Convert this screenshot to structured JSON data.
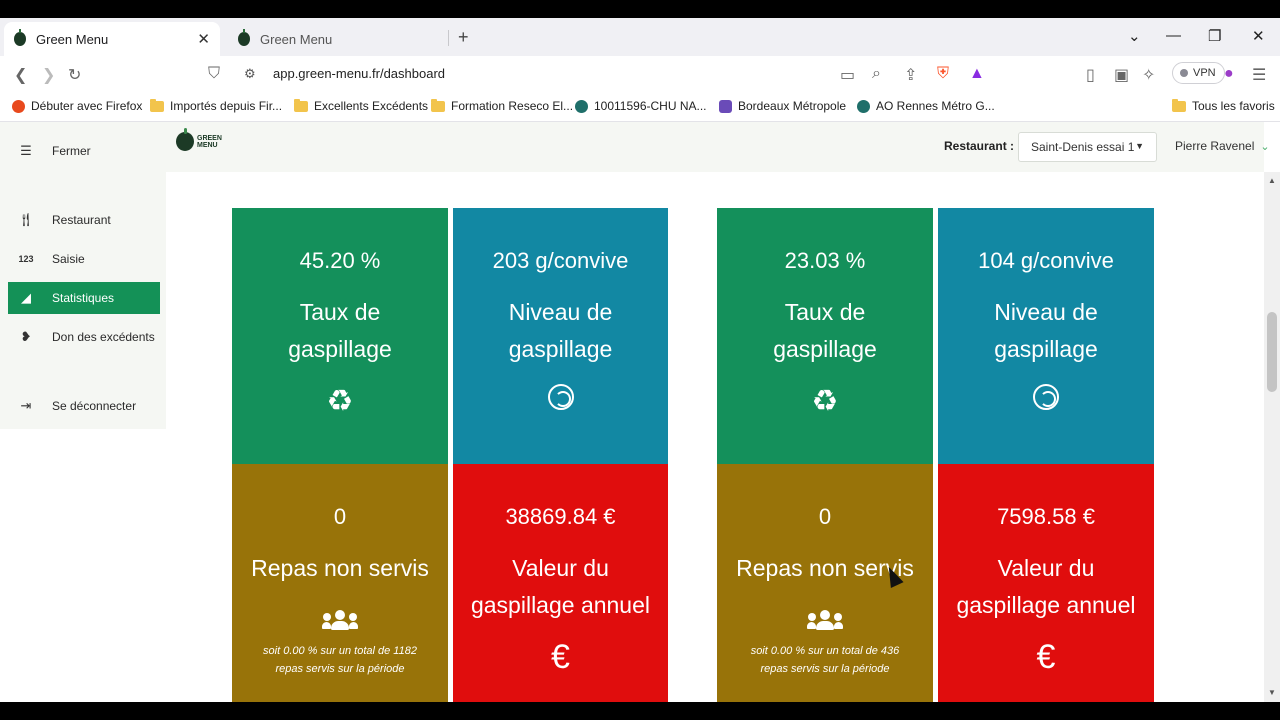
{
  "browser": {
    "tabs": [
      {
        "title": "Green Menu",
        "active": true
      },
      {
        "title": "Green Menu",
        "active": false
      }
    ],
    "url": "app.green-menu.fr/dashboard",
    "vpn_label": "VPN",
    "bookmarks": [
      "Débuter avec Firefox",
      "Importés depuis Fir...",
      "Excellents Excédents",
      "Formation Reseco El...",
      "10011596-CHU NA...",
      "Bordeaux Métropole",
      "AO Rennes Métro G...",
      "Tous les favoris"
    ]
  },
  "app": {
    "logo_line1": "GREEN",
    "logo_line2": "MENU",
    "restaurant_label": "Restaurant :",
    "restaurant_value": "Saint-Denis essai 1",
    "user_name": "Pierre Ravenel",
    "sidebar": {
      "toggle_label": "Fermer",
      "items": [
        {
          "label": "Restaurant",
          "icon": "utensils-icon"
        },
        {
          "label": "Saisie",
          "icon": "numbers-icon"
        },
        {
          "label": "Statistiques",
          "icon": "chart-area-icon",
          "active": true
        },
        {
          "label": "Don des excédents",
          "icon": "hand-heart-icon"
        },
        {
          "label": "Se déconnecter",
          "icon": "sign-out-icon"
        }
      ]
    },
    "panels": [
      {
        "taux_value": "45.20 %",
        "taux_label": "Taux de gaspillage",
        "niveau_value": "203 g/convive",
        "niveau_label": "Niveau de gaspillage",
        "repas_value": "0",
        "repas_label": "Repas non servis",
        "repas_note": "soit 0.00 % sur un total de 1182 repas servis sur la période",
        "valeur_value": "38869.84 €",
        "valeur_label": "Valeur du gaspillage annuel"
      },
      {
        "taux_value": "23.03 %",
        "taux_label": "Taux de gaspillage",
        "niveau_value": "104 g/convive",
        "niveau_label": "Niveau de gaspillage",
        "repas_value": "0",
        "repas_label": "Repas non servis",
        "repas_note": "soit 0.00 % sur un total de 436 repas servis sur la période",
        "valeur_value": "7598.58 €",
        "valeur_label": "Valeur du gaspillage annuel"
      }
    ],
    "colors": {
      "green": "#14905b",
      "teal": "#1288a3",
      "olive": "#987309",
      "red": "#e00d0d",
      "sidebar_active": "#149157"
    }
  }
}
